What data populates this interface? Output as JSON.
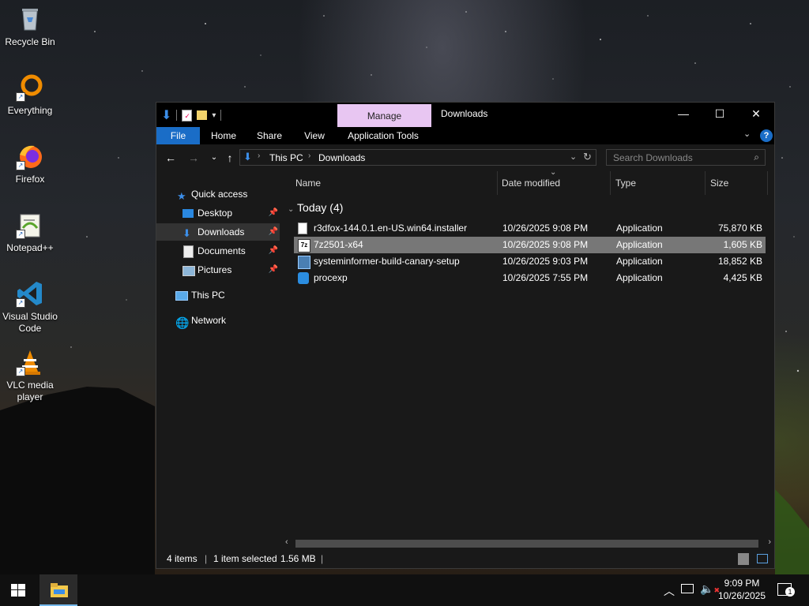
{
  "desktop": {
    "icons": [
      {
        "label": "Recycle Bin"
      },
      {
        "label": "Everything"
      },
      {
        "label": "Firefox"
      },
      {
        "label": "Notepad++"
      },
      {
        "label": "Visual Studio Code"
      },
      {
        "label": "VLC media player"
      }
    ]
  },
  "window": {
    "title": "Downloads",
    "manage_tab": "Manage",
    "ribbon_tabs": [
      "File",
      "Home",
      "Share",
      "View",
      "Application Tools"
    ],
    "address": {
      "segments": [
        "This PC",
        "Downloads"
      ]
    },
    "search": {
      "placeholder": "Search Downloads"
    },
    "nav": {
      "quick_access": "Quick access",
      "items": [
        "Desktop",
        "Downloads",
        "Documents",
        "Pictures"
      ],
      "this_pc": "This PC",
      "network": "Network"
    },
    "columns": {
      "name": "Name",
      "date": "Date modified",
      "type": "Type",
      "size": "Size"
    },
    "group": "Today (4)",
    "files": [
      {
        "name": "r3dfox-144.0.1.en-US.win64.installer",
        "date": "10/26/2025 9:08 PM",
        "type": "Application",
        "size": "75,870 KB",
        "selected": false
      },
      {
        "name": "7z2501-x64",
        "date": "10/26/2025 9:08 PM",
        "type": "Application",
        "size": "1,605 KB",
        "selected": true
      },
      {
        "name": "systeminformer-build-canary-setup",
        "date": "10/26/2025 9:03 PM",
        "type": "Application",
        "size": "18,852 KB",
        "selected": false
      },
      {
        "name": "procexp",
        "date": "10/26/2025 7:55 PM",
        "type": "Application",
        "size": "4,425 KB",
        "selected": false
      }
    ],
    "status": {
      "items": "4 items",
      "selected": "1 item selected",
      "size": "1.56 MB"
    }
  },
  "taskbar": {
    "time": "9:09 PM",
    "date": "10/26/2025",
    "notification_count": "1"
  },
  "colors": {
    "file_tab": "#1a6dc7",
    "manage_tab": "#e8c6f2",
    "selected_row": "#777777"
  }
}
